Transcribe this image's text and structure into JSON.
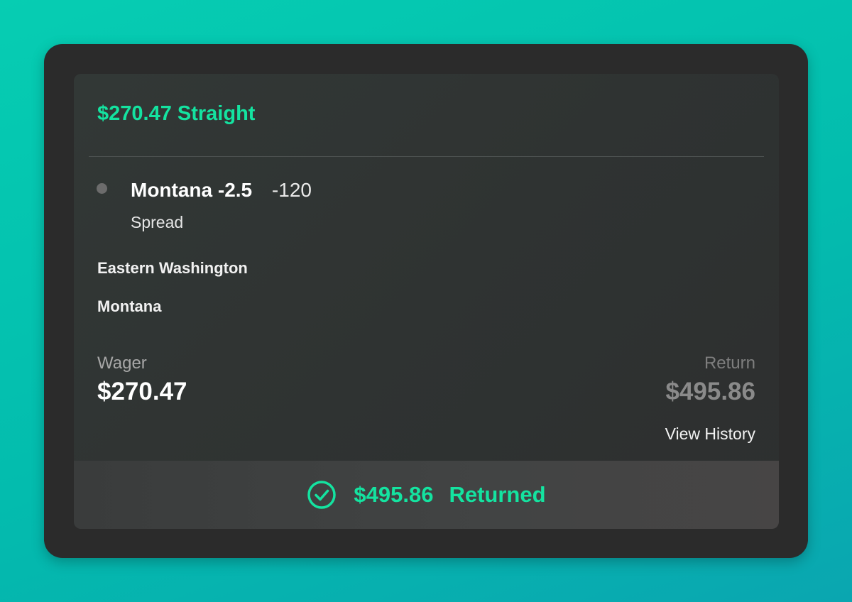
{
  "bet": {
    "title": "$270.47 Straight"
  },
  "selection": {
    "team_line": "Montana -2.5",
    "odds": "-120",
    "market": "Spread"
  },
  "matchup": {
    "away_team": "Eastern Washington",
    "home_team": "Montana"
  },
  "wager": {
    "label": "Wager",
    "value": "$270.47"
  },
  "return": {
    "label": "Return",
    "value": "$495.86"
  },
  "actions": {
    "view_history_label": "View History"
  },
  "footer": {
    "icon": "check-circle-icon",
    "amount": "$495.86",
    "status": "Returned"
  },
  "colors": {
    "accent": "#14e3a0",
    "background_gradient": [
      "#06cdb2",
      "#0aa6b0"
    ],
    "frame": "#2b2b2b",
    "card": "#2f3332"
  }
}
